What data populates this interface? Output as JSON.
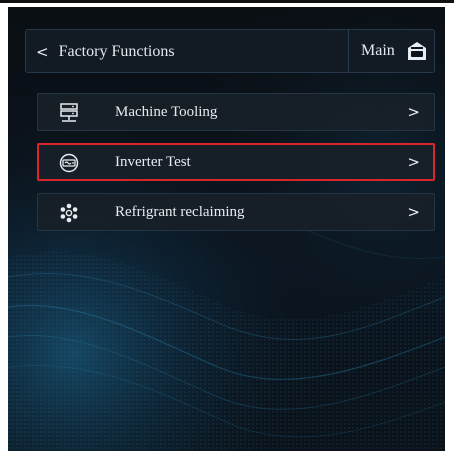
{
  "header": {
    "back_label": "Factory Functions",
    "main_label": "Main"
  },
  "menu": {
    "items": [
      {
        "label": "Machine Tooling",
        "icon": "machine-tooling-icon",
        "selected": false
      },
      {
        "label": "Inverter Test",
        "icon": "inverter-test-icon",
        "selected": true
      },
      {
        "label": "Refrigrant reclaiming",
        "icon": "snowflake-icon",
        "selected": false
      }
    ]
  },
  "colors": {
    "background": "#0b121a",
    "panel": "#181f28",
    "border": "#233445",
    "selected_border": "#d8262b",
    "text": "#e8ebef",
    "accent_wave": "#1e6f9a"
  }
}
